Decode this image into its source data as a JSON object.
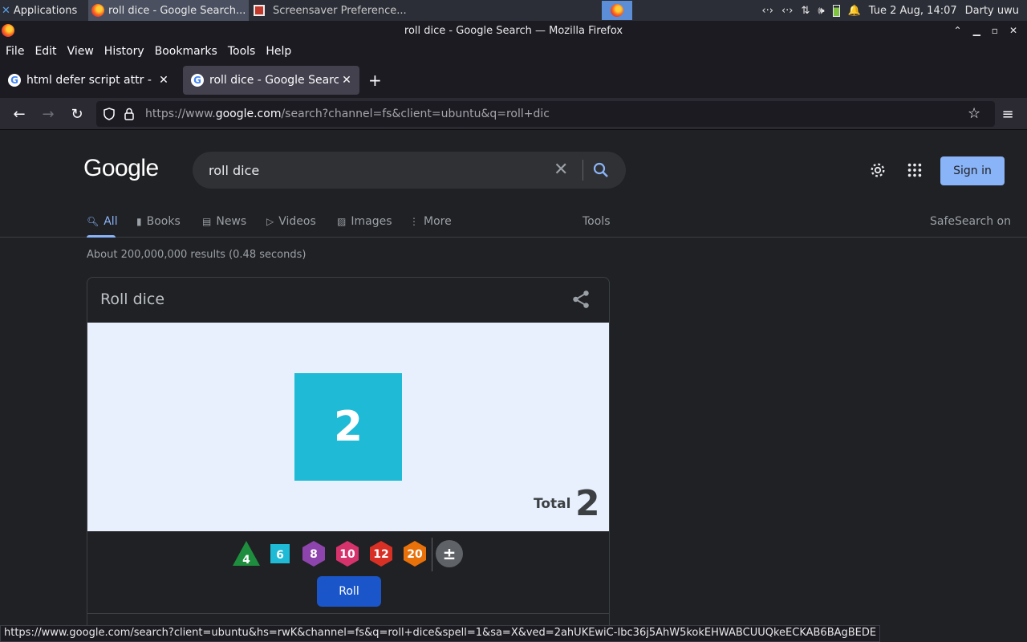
{
  "taskbar": {
    "applications": "Applications",
    "task1": "roll dice - Google Search...",
    "task2": "Screensaver Preference...",
    "clock": "Tue  2 Aug, 14:07",
    "user": "Darty uwu"
  },
  "window": {
    "title": "roll dice - Google Search — Mozilla Firefox"
  },
  "menu": [
    "File",
    "Edit",
    "View",
    "History",
    "Bookmarks",
    "Tools",
    "Help"
  ],
  "tabs": [
    {
      "title": "html defer script attr - Goo"
    },
    {
      "title": "roll dice - Google Search"
    }
  ],
  "url": {
    "scheme": "https://www.",
    "host": "google.com",
    "path": "/search?channel=fs&client=ubuntu&q=roll+dic"
  },
  "google": {
    "logo": "Google",
    "query": "roll dice",
    "sign_in": "Sign in",
    "tabs": [
      "All",
      "Books",
      "News",
      "Videos",
      "Images",
      "More"
    ],
    "tools": "Tools",
    "safesearch": "SafeSearch on",
    "result_stats": "About 200,000,000 results (0.48 seconds)"
  },
  "dice": {
    "title": "Roll dice",
    "rolled_value": "2",
    "total_label": "Total",
    "total_value": "2",
    "buttons": [
      {
        "label": "4",
        "shape": "triangle",
        "color": "#1e8e3e"
      },
      {
        "label": "6",
        "shape": "square",
        "color": "#1ebad6"
      },
      {
        "label": "8",
        "shape": "hexagon",
        "color": "#8e44ad"
      },
      {
        "label": "10",
        "shape": "hexagon",
        "color": "#d6336c"
      },
      {
        "label": "12",
        "shape": "hexagon",
        "color": "#d93025"
      },
      {
        "label": "20",
        "shape": "hexagon",
        "color": "#e8710a"
      },
      {
        "label": "±",
        "shape": "circle",
        "color": "#5f6368"
      }
    ],
    "roll_label": "Roll"
  },
  "status_url": "https://www.google.com/search?client=ubuntu&hs=rwK&channel=fs&q=roll+dice&spell=1&sa=X&ved=2ahUKEwiC-Ibc36j5AhW5kokEHWABCUUQkeECKAB6BAgBEDE"
}
